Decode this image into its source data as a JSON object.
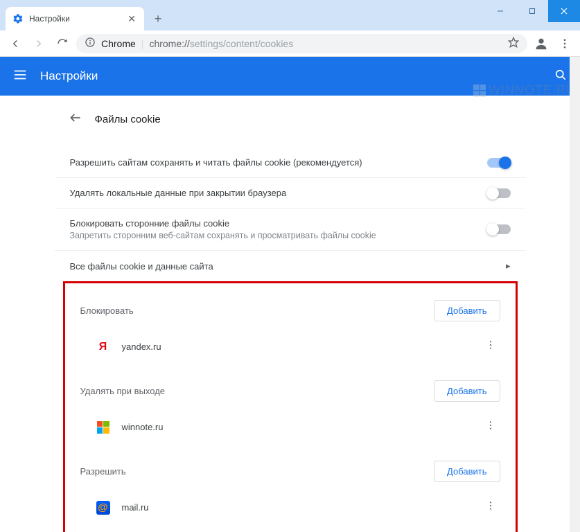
{
  "window": {
    "tab_title": "Настройки"
  },
  "omnibox": {
    "label": "Chrome",
    "prefix": "chrome://",
    "path": "settings/content/cookies"
  },
  "header": {
    "title": "Настройки"
  },
  "watermark": "WINNOTE.RU",
  "page": {
    "title": "Файлы cookie",
    "toggles": {
      "allow": {
        "label": "Разрешить сайтам сохранять и читать файлы cookie (рекомендуется)",
        "on": true
      },
      "clear_on_exit": {
        "label": "Удалять локальные данные при закрытии браузера",
        "on": false
      },
      "block_third_party": {
        "label": "Блокировать сторонние файлы cookie",
        "sub": "Запретить сторонним веб-сайтам сохранять и просматривать файлы cookie",
        "on": false
      }
    },
    "all_cookies": "Все файлы cookie и данные сайта",
    "add_button": "Добавить",
    "sections": {
      "block": {
        "title": "Блокировать",
        "items": [
          {
            "site": "yandex.ru",
            "icon": "yandex"
          }
        ]
      },
      "clear_on_exit_list": {
        "title": "Удалять при выходе",
        "items": [
          {
            "site": "winnote.ru",
            "icon": "windows"
          }
        ]
      },
      "allow_list": {
        "title": "Разрешить",
        "items": [
          {
            "site": "mail.ru",
            "icon": "mail"
          }
        ]
      }
    }
  }
}
